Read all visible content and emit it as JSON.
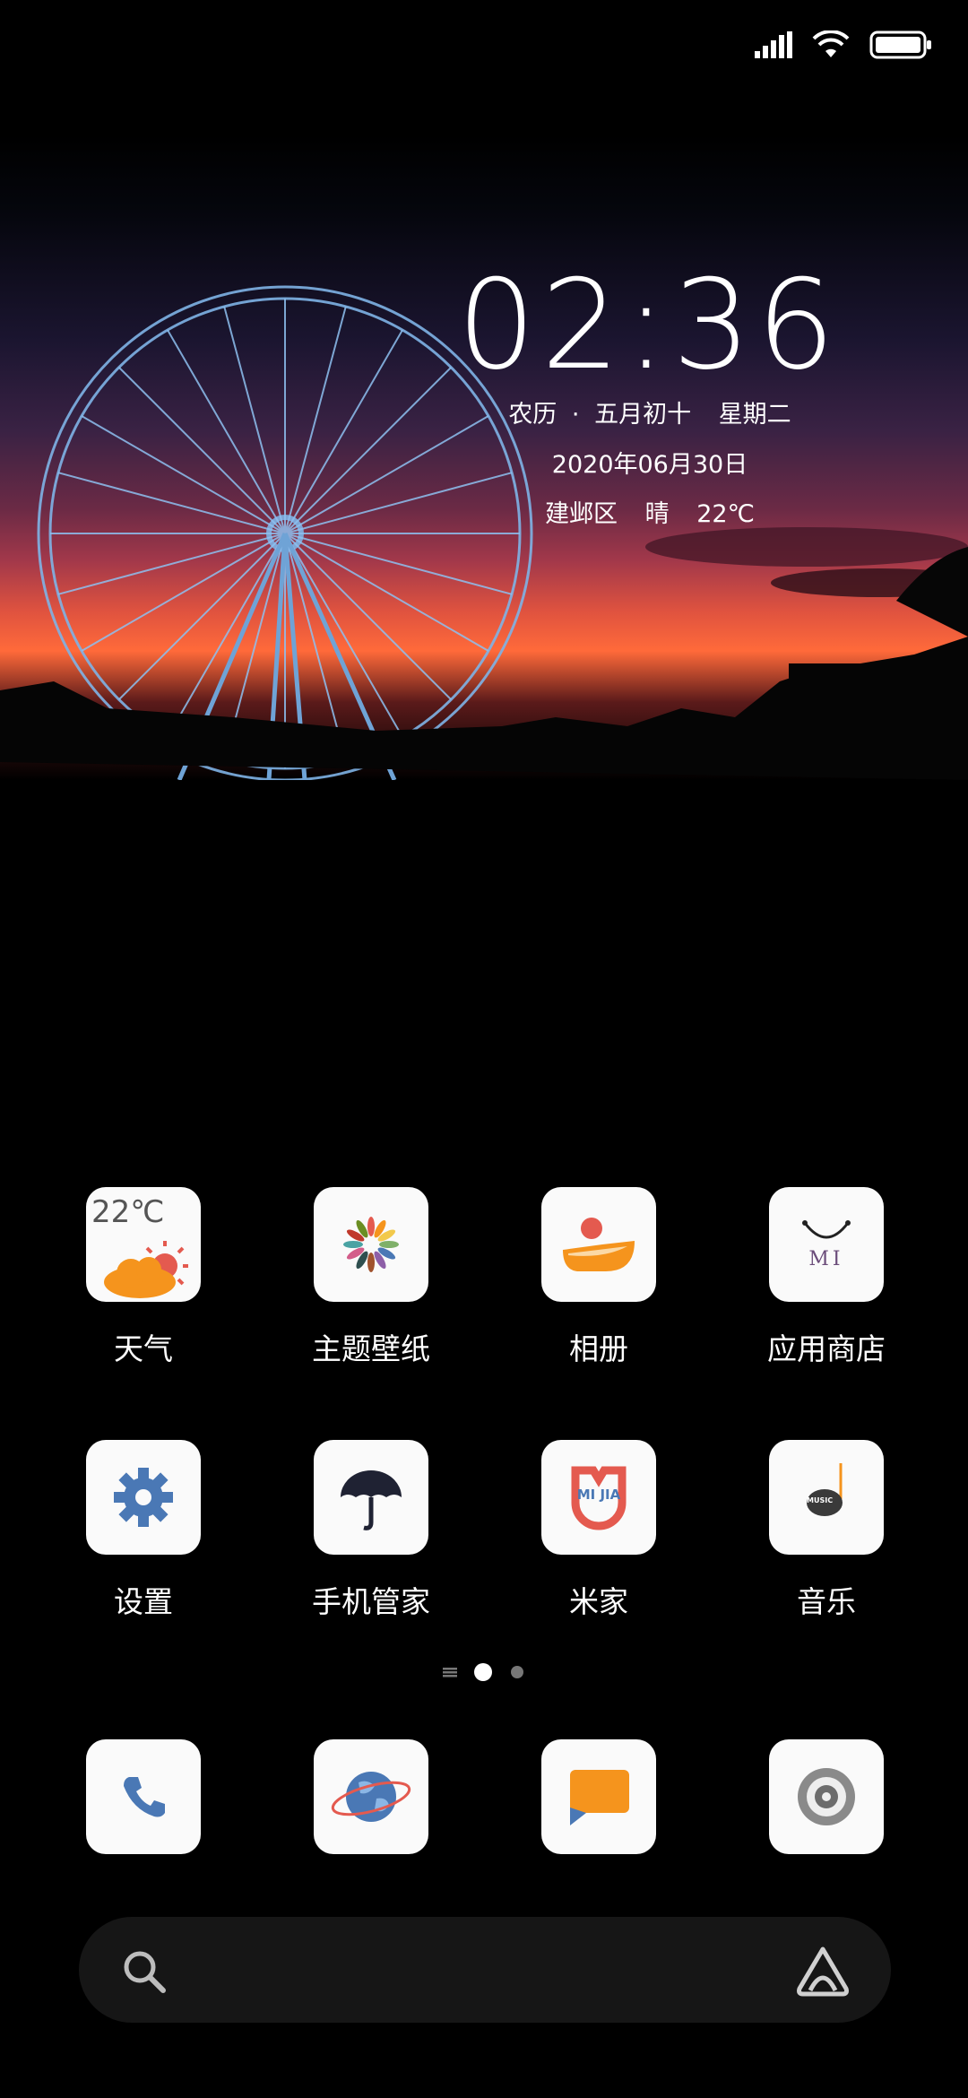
{
  "status_bar": {
    "signal_icon": "cellular-signal-icon",
    "wifi_icon": "wifi-icon",
    "battery_icon": "battery-full-icon"
  },
  "clock": {
    "time": "02:36"
  },
  "lunar": {
    "calendar": "农历",
    "separator": "·",
    "lunar_date": "五月初十",
    "weekday": "星期二"
  },
  "date": "2020年06月30日",
  "weather": {
    "location": "建邺区",
    "condition": "晴",
    "temperature": "22℃"
  },
  "apps": [
    {
      "label": "天气",
      "icon": "weather-icon",
      "icon_text": "22℃"
    },
    {
      "label": "主题壁纸",
      "icon": "themes-icon"
    },
    {
      "label": "相册",
      "icon": "gallery-icon"
    },
    {
      "label": "应用商店",
      "icon": "app-store-icon",
      "icon_text": "MI"
    },
    {
      "label": "设置",
      "icon": "gear-icon"
    },
    {
      "label": "手机管家",
      "icon": "umbrella-icon"
    },
    {
      "label": "米家",
      "icon": "mijia-icon",
      "icon_text": "MI JIA"
    },
    {
      "label": "音乐",
      "icon": "music-icon",
      "icon_text": "MUSIC"
    }
  ],
  "page_indicator": {
    "current": 2,
    "total": 2
  },
  "dock": [
    {
      "icon": "phone-icon"
    },
    {
      "icon": "browser-globe-icon"
    },
    {
      "icon": "messages-icon"
    },
    {
      "icon": "camera-icon"
    }
  ],
  "search": {
    "icon": "search-icon",
    "assistant_icon": "assistant-icon"
  },
  "colors": {
    "accent_orange": "#f5941d",
    "settings_blue": "#4a78b5",
    "mijia_red": "#e45a4f"
  }
}
